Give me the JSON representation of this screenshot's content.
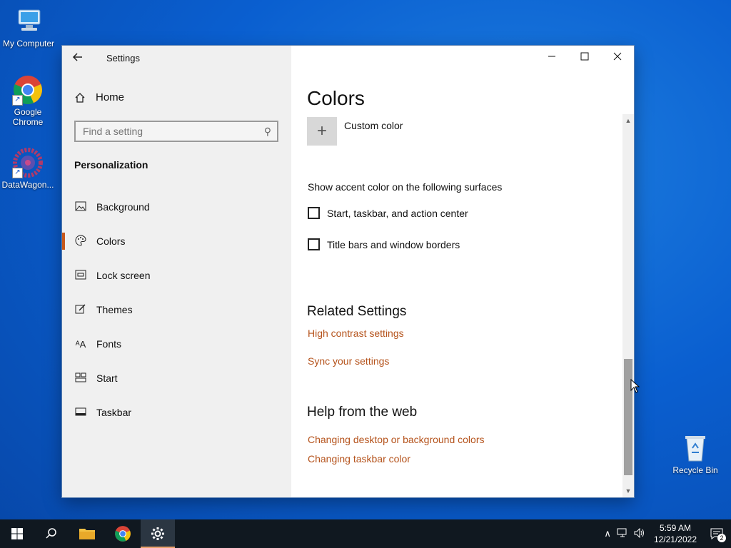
{
  "desktop": {
    "icons": [
      {
        "label": "My Computer"
      },
      {
        "label": "Google Chrome"
      },
      {
        "label": "DataWagon..."
      },
      {
        "label": "Recycle Bin"
      }
    ]
  },
  "window": {
    "app_title": "Settings",
    "home_label": "Home",
    "search_placeholder": "Find a setting",
    "section_title": "Personalization",
    "nav": [
      {
        "label": "Background",
        "icon": "picture-icon"
      },
      {
        "label": "Colors",
        "icon": "palette-icon",
        "active": true
      },
      {
        "label": "Lock screen",
        "icon": "lock-screen-icon"
      },
      {
        "label": "Themes",
        "icon": "brush-icon"
      },
      {
        "label": "Fonts",
        "icon": "font-icon"
      },
      {
        "label": "Start",
        "icon": "start-icon"
      },
      {
        "label": "Taskbar",
        "icon": "taskbar-icon"
      }
    ],
    "controls": {
      "minimize": "—",
      "maximize": "☐",
      "close": "✕"
    }
  },
  "content": {
    "page_title": "Colors",
    "custom_color_label": "Custom color",
    "surfaces_label": "Show accent color on the following surfaces",
    "checkboxes": [
      {
        "label": "Start, taskbar, and action center",
        "checked": false
      },
      {
        "label": "Title bars and window borders",
        "checked": false
      }
    ],
    "related_title": "Related Settings",
    "related_links": [
      "High contrast settings",
      "Sync your settings"
    ],
    "help_title": "Help from the web",
    "help_links": [
      "Changing desktop or background colors",
      "Changing taskbar color"
    ]
  },
  "taskbar": {
    "time": "5:59 AM",
    "date": "12/21/2022",
    "notification_count": "2"
  },
  "colors": {
    "accent": "#c7581b",
    "link": "#b5531c",
    "taskbar": "#101820"
  }
}
